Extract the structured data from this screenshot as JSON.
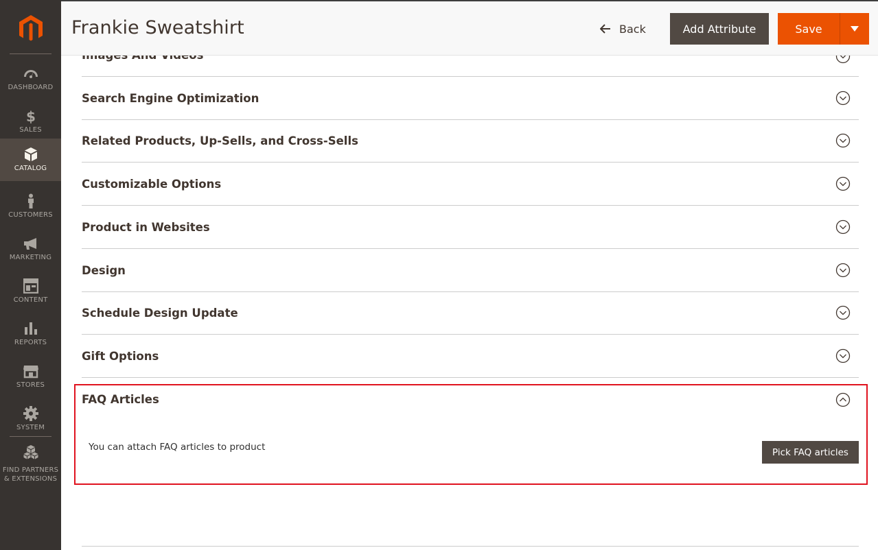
{
  "sidebar": {
    "items": [
      {
        "label": "DASHBOARD",
        "icon": "dashboard-icon"
      },
      {
        "label": "SALES",
        "icon": "dollar-icon"
      },
      {
        "label": "CATALOG",
        "icon": "box-icon",
        "active": true
      },
      {
        "label": "CUSTOMERS",
        "icon": "person-icon"
      },
      {
        "label": "MARKETING",
        "icon": "megaphone-icon"
      },
      {
        "label": "CONTENT",
        "icon": "layout-icon"
      },
      {
        "label": "REPORTS",
        "icon": "bar-chart-icon"
      },
      {
        "label": "STORES",
        "icon": "storefront-icon"
      },
      {
        "label": "SYSTEM",
        "icon": "gear-icon"
      }
    ],
    "partners": {
      "line1": "FIND PARTNERS",
      "line2": "& EXTENSIONS",
      "icon": "cubes-icon"
    }
  },
  "header": {
    "title": "Frankie Sweatshirt",
    "back_label": "Back",
    "add_attribute_label": "Add Attribute",
    "save_label": "Save"
  },
  "sections": {
    "partial": "Images And Videos",
    "items": [
      "Search Engine Optimization",
      "Related Products, Up-Sells, and Cross-Sells",
      "Customizable Options",
      "Product in Websites",
      "Design",
      "Schedule Design Update",
      "Gift Options"
    ]
  },
  "faq": {
    "title": "FAQ Articles",
    "description": "You can attach FAQ articles to product",
    "pick_label": "Pick FAQ articles"
  },
  "colors": {
    "sidebar_bg": "#373330",
    "sidebar_active": "#514943",
    "brand_orange": "#eb5202",
    "button_dark": "#514943",
    "highlight_red": "#e0121e"
  }
}
